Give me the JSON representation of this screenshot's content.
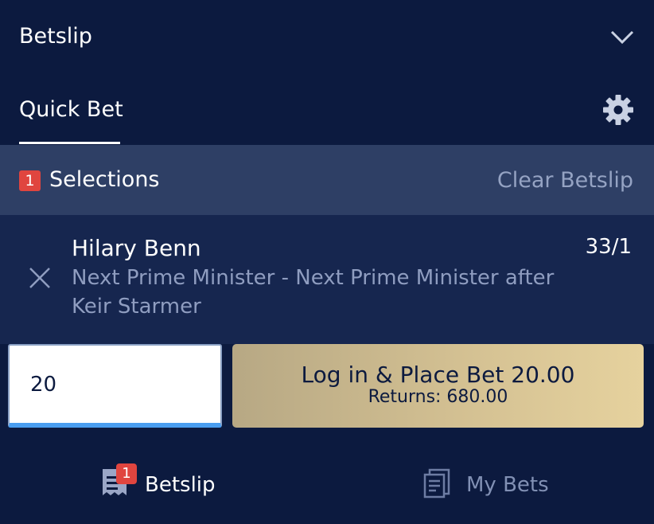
{
  "header": {
    "title": "Betslip",
    "collapse_icon": "chevron-down-icon"
  },
  "tabs": {
    "active_label": "Quick Bet",
    "settings_icon": "gear-icon"
  },
  "selections": {
    "count": "1",
    "label": "Selections",
    "clear_label": "Clear Betslip"
  },
  "selection": {
    "name": "Hilary Benn",
    "odds": "33/1",
    "market": "Next Prime Minister - Next Prime Minister after Keir Starmer",
    "remove_icon": "close-icon"
  },
  "stake": {
    "value": "20"
  },
  "place_bet": {
    "label": "Log in & Place Bet 20.00",
    "returns": "Returns: 680.00"
  },
  "bottom_nav": {
    "betslip": {
      "label": "Betslip",
      "badge": "1",
      "icon": "receipt-icon"
    },
    "my_bets": {
      "label": "My Bets",
      "icon": "tickets-icon"
    }
  },
  "colors": {
    "background": "#0c1a3f",
    "selections_bar": "#2e3f65",
    "selection_bg": "#16264f",
    "badge": "#e0453f",
    "accent_gold": "#d3c092",
    "input_underline": "#4a9ef0"
  }
}
